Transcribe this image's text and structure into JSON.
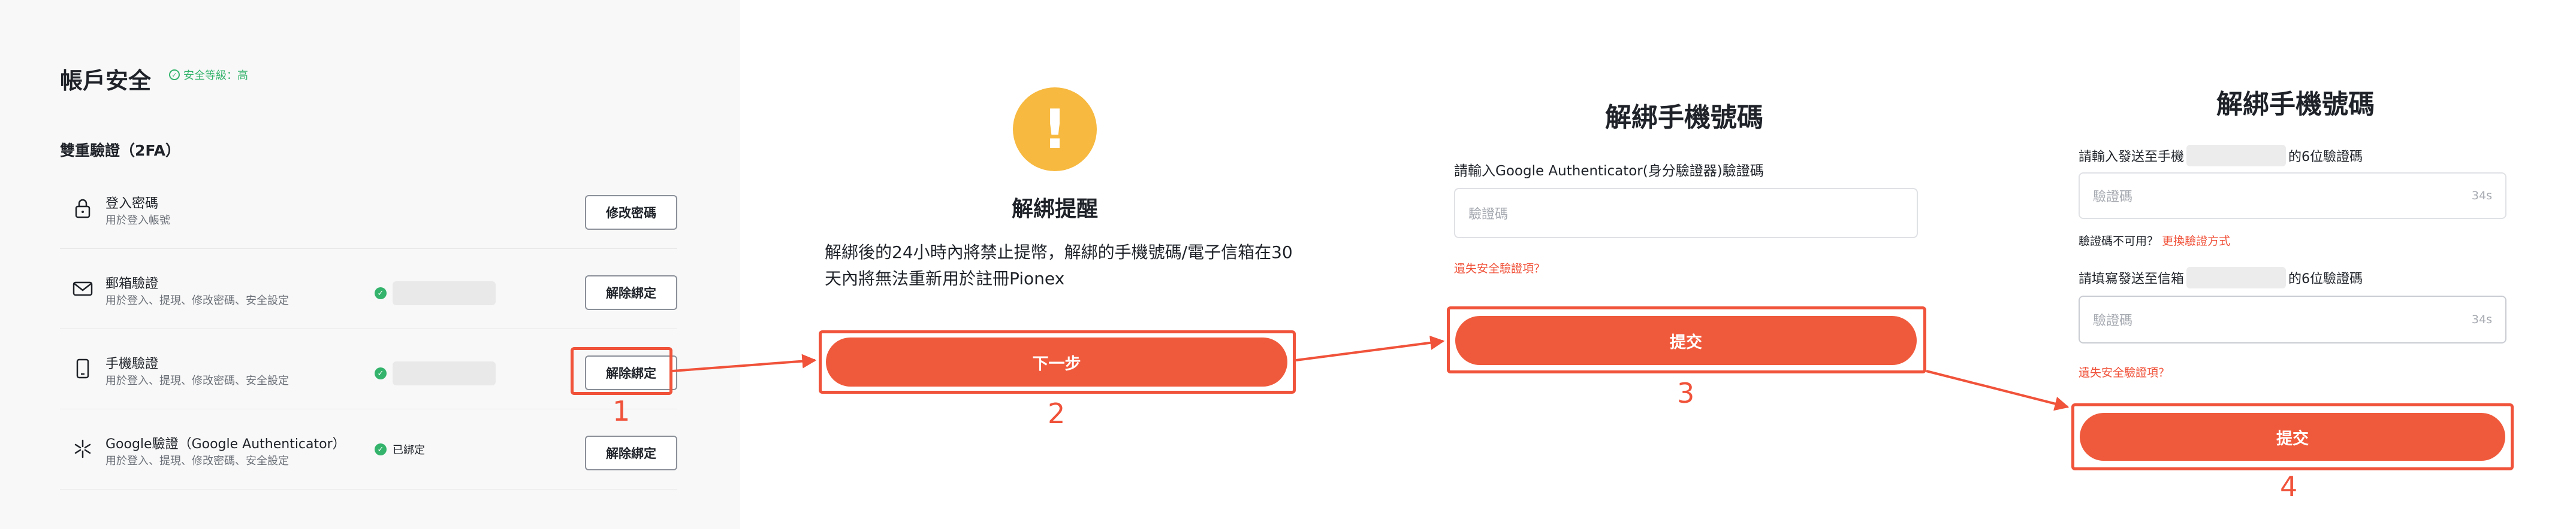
{
  "panel1": {
    "title": "帳戶安全",
    "security_level": "安全等級：高",
    "section_title": "雙重驗證（2FA）",
    "rows": [
      {
        "name": "登入密碼",
        "desc": "用於登入帳號",
        "status": "",
        "button": "修改密碼"
      },
      {
        "name": "郵箱驗證",
        "desc": "用於登入、提現、修改密碼、安全設定",
        "status": "",
        "button": "解除綁定"
      },
      {
        "name": "手機驗證",
        "desc": "用於登入、提現、修改密碼、安全設定",
        "status": "",
        "button": "解除綁定"
      },
      {
        "name": "Google驗證（Google Authenticator）",
        "desc": "用於登入、提現、修改密碼、安全設定",
        "status": "已綁定",
        "button": "解除綁定"
      }
    ]
  },
  "panel2": {
    "title": "解綁提醒",
    "body": "解綁後的24小時內將禁止提幣，解綁的手機號碼/電子信箱在30天內將無法重新用於註冊Pionex",
    "button": "下一步"
  },
  "panel3": {
    "title": "解綁手機號碼",
    "label": "請輸入Google Authenticator(身分驗證器)驗證碼",
    "placeholder": "驗證碼",
    "lost_link": "遺失安全驗證項？",
    "button": "提交"
  },
  "panel4": {
    "title": "解綁手機號碼",
    "phone_label_prefix": "請輸入發送至手機",
    "phone_label_suffix": "的6位驗證碼",
    "placeholder": "驗證碼",
    "countdown": "34s",
    "unavailable_text": "驗證碼不可用？",
    "change_method": "更換驗證方式",
    "email_label_prefix": "請填寫發送至信箱",
    "email_label_suffix": "的6位驗證碼",
    "lost_link": "遺失安全驗證項？",
    "button": "提交"
  },
  "annotations": [
    "1",
    "2",
    "3",
    "4"
  ],
  "colors": {
    "accent": "#f05a3c",
    "annotation": "#f0523a",
    "success": "#33b36b",
    "warning": "#f7b93f"
  }
}
